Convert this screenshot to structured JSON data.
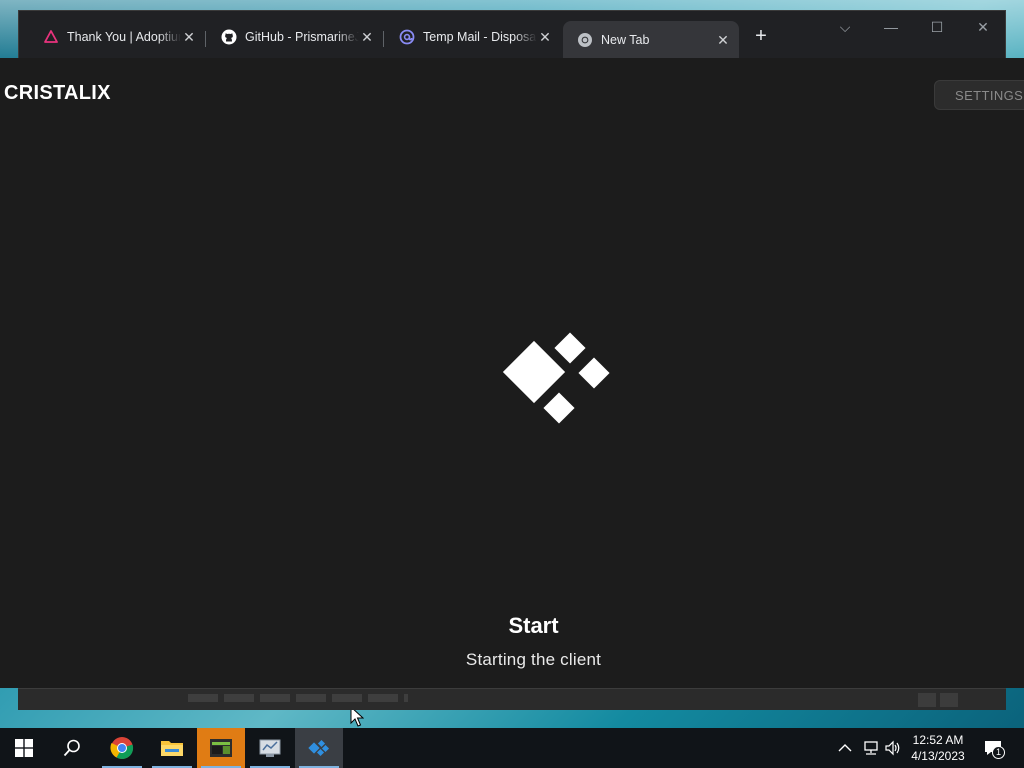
{
  "browser": {
    "tabs": [
      {
        "title": "Thank You | Adoptium",
        "icon": "adoptium-icon"
      },
      {
        "title": "GitHub - PrismarineJS",
        "icon": "github-icon"
      },
      {
        "title": "Temp Mail - Disposable",
        "icon": "at-sign-icon"
      },
      {
        "title": "New Tab",
        "icon": "chrome-icon"
      }
    ],
    "tab_close_glyph": "✕",
    "new_tab_glyph": "+",
    "controls": {
      "tab_search": "⌵",
      "minimize": "—",
      "maximize": "☐",
      "close": "✕"
    }
  },
  "launcher": {
    "brand": "CRISTALIX",
    "settings_label": "SETTINGS",
    "status_title": "Start",
    "status_subtitle": "Starting the client",
    "accent": "#ffffff",
    "background": "#1c1c1c"
  },
  "taskbar": {
    "apps": [
      {
        "name": "start",
        "icon": "windows-icon"
      },
      {
        "name": "search",
        "icon": "search-icon"
      },
      {
        "name": "chrome",
        "icon": "chrome-icon"
      },
      {
        "name": "file-explorer",
        "icon": "folder-icon"
      },
      {
        "name": "minecraft",
        "icon": "minecraft-icon"
      },
      {
        "name": "server-manager",
        "icon": "server-manager-icon"
      },
      {
        "name": "cristalix",
        "icon": "cristalix-icon"
      }
    ],
    "time": "12:52 AM",
    "date": "4/13/2023",
    "notification_count": "1"
  }
}
